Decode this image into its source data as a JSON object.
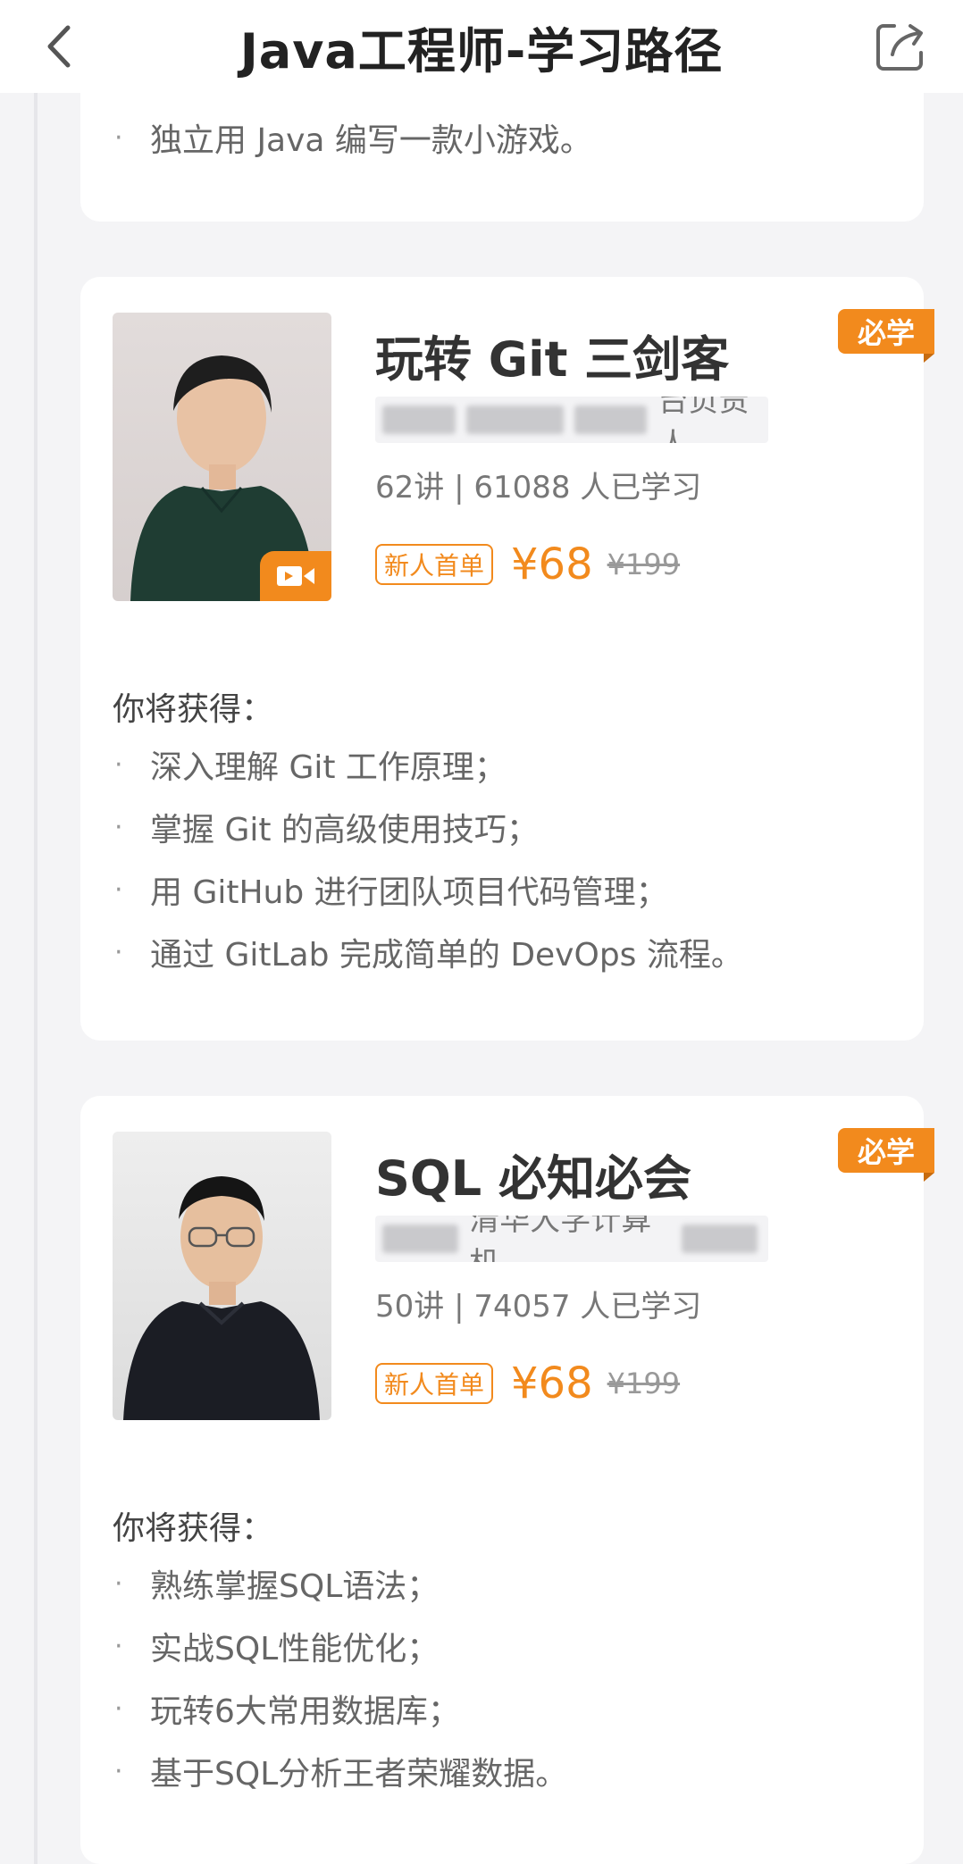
{
  "header": {
    "title": "Java工程师-学习路径"
  },
  "prev_card": {
    "bullets": [
      "独立用 Java 编写一款小游戏。"
    ]
  },
  "courses": [
    {
      "title": "玩转 Git 三剑客",
      "badge": "必学",
      "author": "台负责人",
      "stats": "62讲 | 61088 人已学习",
      "tag": "新人首单",
      "price": "¥68",
      "old_price": "¥199",
      "gain_title": "你将获得：",
      "gains": [
        "深入理解 Git 工作原理；",
        "掌握 Git 的高级使用技巧；",
        "用 GitHub 进行团队项目代码管理；",
        "通过 GitLab 完成简单的 DevOps 流程。"
      ]
    },
    {
      "title": "SQL 必知必会",
      "badge": "必学",
      "author": "清华大学计算机",
      "stats": "50讲 | 74057 人已学习",
      "tag": "新人首单",
      "price": "¥68",
      "old_price": "¥199",
      "gain_title": "你将获得：",
      "gains": [
        "熟练掌握SQL语法；",
        "实战SQL性能优化；",
        "玩转6大常用数据库；",
        "基于SQL分析王者荣耀数据。"
      ]
    }
  ],
  "colors": {
    "accent": "#f28a1d",
    "text": "#333333",
    "muted": "#777777"
  },
  "icons": {
    "back": "chevron-left-icon",
    "share": "share-icon",
    "video": "video-camera-icon"
  }
}
